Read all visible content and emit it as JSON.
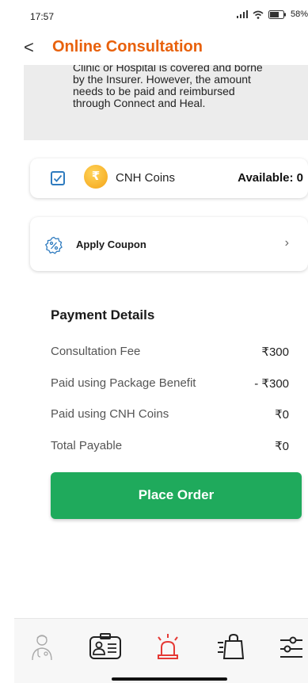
{
  "status": {
    "time": "17:57",
    "battery": "58%"
  },
  "header": {
    "back_glyph": "<",
    "title": "Online Consultation"
  },
  "info": {
    "lines": [
      "Clinic or Hospital is covered and borne",
      "by the Insurer. However, the amount",
      "needs to be paid and reimbursed",
      "through Connect and Heal."
    ]
  },
  "coins": {
    "checked": true,
    "coin_symbol": "₹",
    "label": "CNH Coins",
    "available": "Available: 0"
  },
  "coupon": {
    "label": "Apply Coupon",
    "chevron": "›"
  },
  "payment": {
    "title": "Payment Details",
    "rows": [
      {
        "label": "Consultation Fee",
        "value": "₹300"
      },
      {
        "label": "Paid using Package Benefit",
        "value": "- ₹300"
      },
      {
        "label": "Paid using CNH Coins",
        "value": "₹0"
      },
      {
        "label": "Total Payable",
        "value": "₹0"
      }
    ]
  },
  "actions": {
    "place_order": "Place Order"
  },
  "nav": {
    "items": [
      {
        "icon": "doctor-icon",
        "active": false
      },
      {
        "icon": "id-card-icon",
        "active": false
      },
      {
        "icon": "emergency-alarm-icon",
        "active": true
      },
      {
        "icon": "shopping-bag-icon",
        "active": false
      },
      {
        "icon": "settings-sliders-icon",
        "active": false
      }
    ]
  },
  "colors": {
    "accent": "#e8610c",
    "primary_button": "#1faa5c",
    "emergency": "#e53935"
  }
}
